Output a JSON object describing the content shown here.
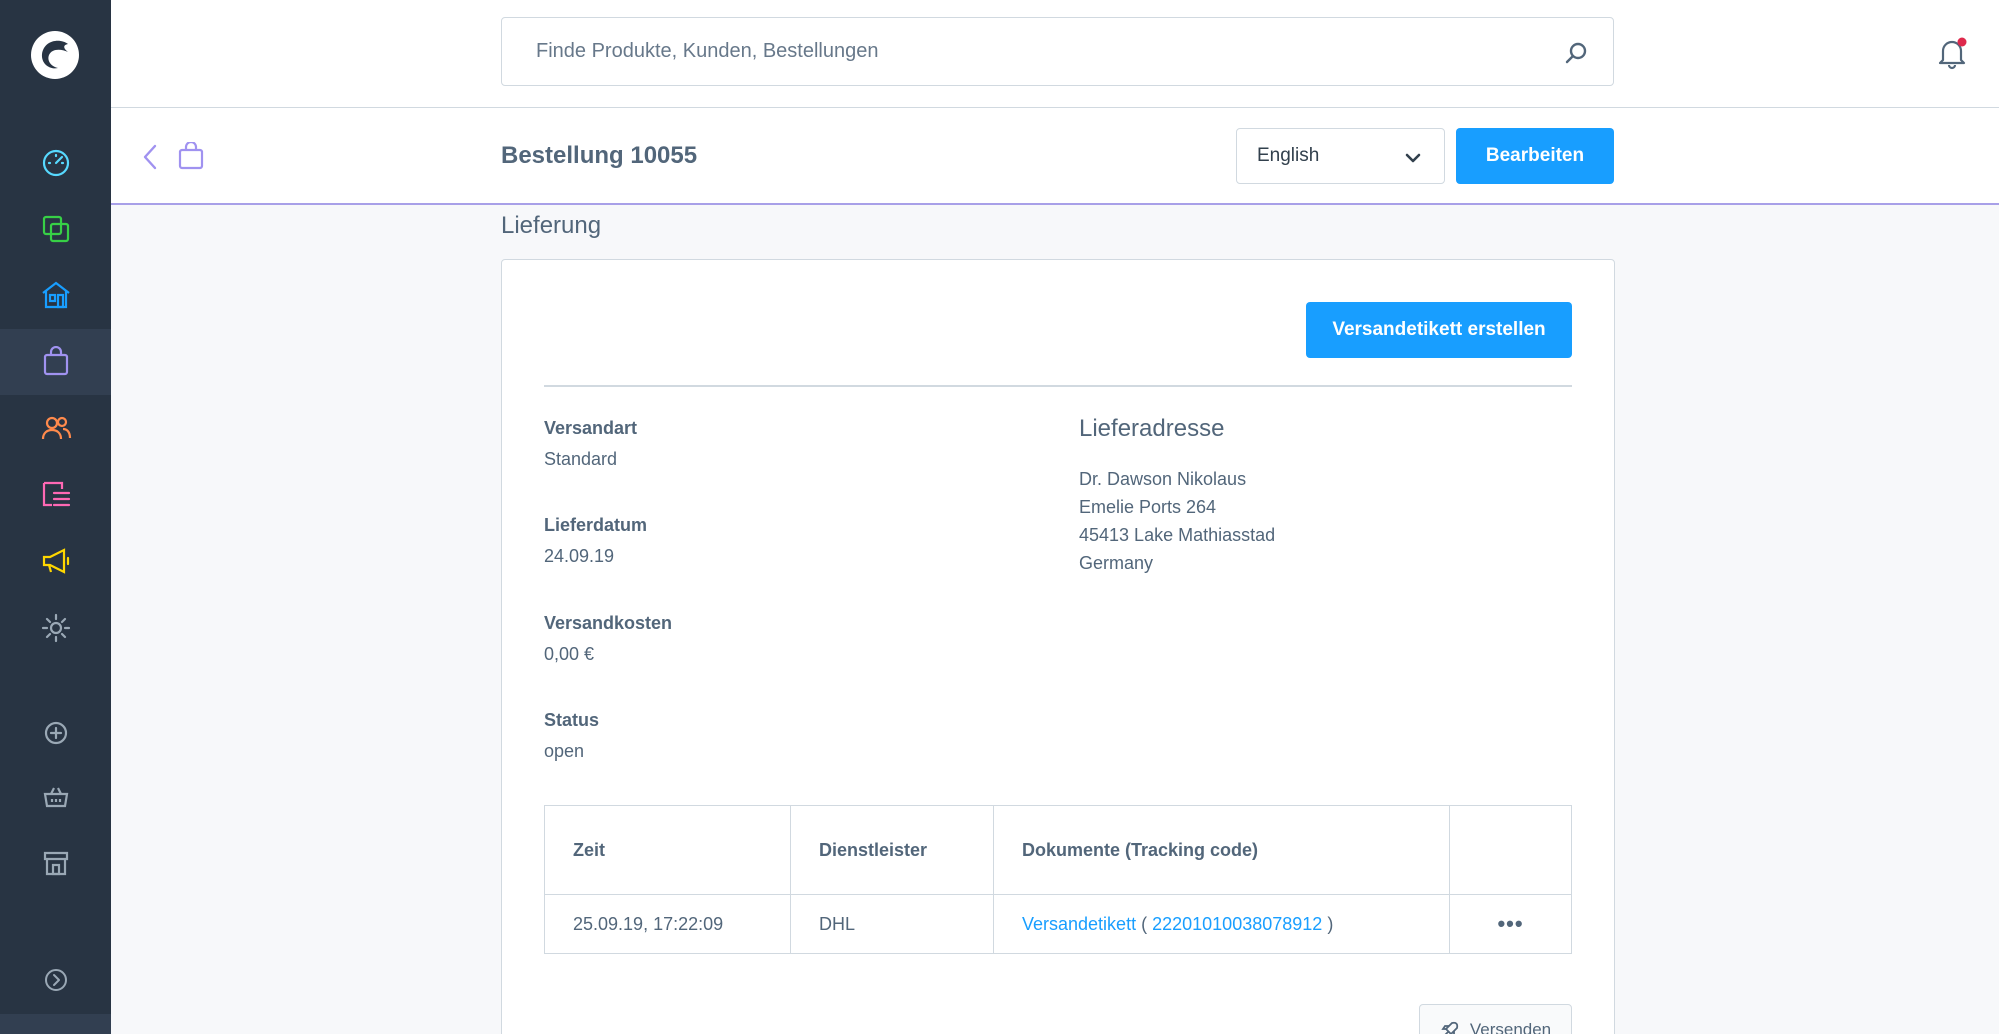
{
  "colors": {
    "sidebar_bg": "#283443",
    "accent": "#189eff",
    "text": "#52667a"
  },
  "sidebar": {
    "logo": "shopware-logo",
    "items": [
      {
        "icon": "dashboard-icon",
        "color": "#57d9ff"
      },
      {
        "icon": "products-icon",
        "color": "#37d046"
      },
      {
        "icon": "storefront-icon",
        "color": "#189eff"
      },
      {
        "icon": "orders-icon",
        "color": "#a092f0",
        "active": true
      },
      {
        "icon": "customers-icon",
        "color": "#ff8a4c"
      },
      {
        "icon": "content-icon",
        "color": "#ff68b4"
      },
      {
        "icon": "marketing-icon",
        "color": "#ffd700"
      },
      {
        "icon": "settings-icon",
        "color": "#9aa8b5"
      },
      {
        "icon": "plus-circle-icon",
        "color": "#9aa8b5"
      },
      {
        "icon": "basket-icon",
        "color": "#9aa8b5"
      },
      {
        "icon": "store-icon",
        "color": "#9aa8b5"
      },
      {
        "icon": "collapse-icon",
        "color": "#9aa8b5"
      }
    ]
  },
  "search": {
    "placeholder": "Finde Produkte, Kunden, Bestellungen"
  },
  "header": {
    "title": "Bestellung 10055",
    "language": "English",
    "edit_label": "Bearbeiten"
  },
  "delivery": {
    "section_title": "Lieferung",
    "create_label_button": "Versandetikett erstellen",
    "fields": [
      {
        "label": "Versandart",
        "value": "Standard"
      },
      {
        "label": "Lieferdatum",
        "value": "24.09.19"
      },
      {
        "label": "Versandkosten",
        "value": "0,00 €"
      },
      {
        "label": "Status",
        "value": "open"
      }
    ],
    "address": {
      "heading": "Lieferadresse",
      "lines": [
        "Dr. Dawson Nikolaus",
        "Emelie Ports 264",
        "45413 Lake Mathiasstad",
        "Germany"
      ]
    },
    "table": {
      "headers": [
        "Zeit",
        "Dienstleister",
        "Dokumente (Tracking code)",
        ""
      ],
      "rows": [
        {
          "time": "25.09.19, 17:22:09",
          "provider": "DHL",
          "document": "Versandetikett",
          "paren_open": "(",
          "tracking": "222010100380789​12",
          "paren_close": ")",
          "actions": "•••"
        }
      ]
    },
    "send_button": "Versenden"
  }
}
